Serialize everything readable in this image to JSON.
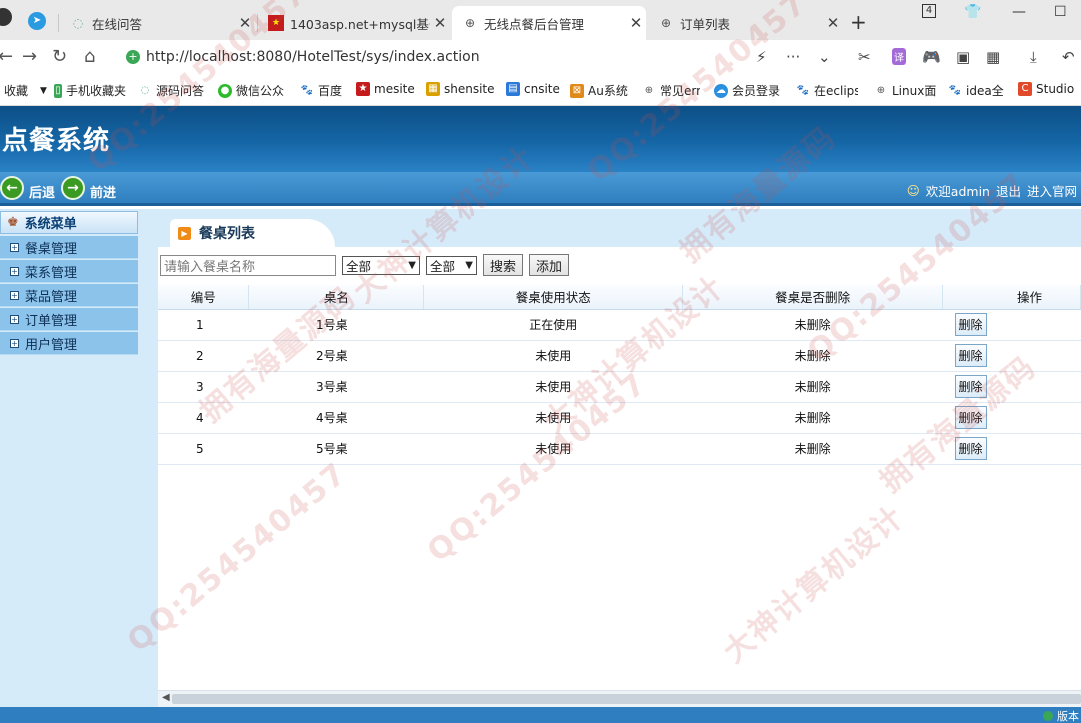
{
  "browser": {
    "tabs": [
      {
        "title": "在线问答",
        "favicon": "web-icon",
        "active": false
      },
      {
        "title": "1403asp.net+mysql基于",
        "favicon": "red-square-icon",
        "active": false
      },
      {
        "title": "无线点餐后台管理",
        "favicon": "globe-icon",
        "active": true
      },
      {
        "title": "订单列表",
        "favicon": "globe-icon",
        "active": false
      }
    ],
    "tab_badge": "4",
    "url": "http://localhost:8080/HotelTest/sys/index.action",
    "url_host": "localhost",
    "bookmarks": [
      {
        "label": "收藏",
        "icon": "caret-down-icon"
      },
      {
        "label": "手机收藏夹",
        "icon": "phone-icon"
      },
      {
        "label": "源码问答",
        "icon": "web-icon"
      },
      {
        "label": "微信公众",
        "icon": "wechat-icon"
      },
      {
        "label": "百度",
        "icon": "baidu-paw-icon"
      },
      {
        "label": "mesite",
        "icon": "red-square-icon"
      },
      {
        "label": "shensite",
        "icon": "grid-icon"
      },
      {
        "label": "cnsite",
        "icon": "doc-icon"
      },
      {
        "label": "Au系统",
        "icon": "x-box-icon"
      },
      {
        "label": "常见err",
        "icon": "globe-icon"
      },
      {
        "label": "会员登录",
        "icon": "cloud-icon"
      },
      {
        "label": "在eclips",
        "icon": "baidu-paw-icon"
      },
      {
        "label": "Linux面",
        "icon": "globe-icon"
      },
      {
        "label": "idea全",
        "icon": "baidu-paw-icon"
      },
      {
        "label": "Studio",
        "icon": "c-icon"
      }
    ]
  },
  "app": {
    "title": "点餐系统",
    "nav": {
      "back": "后退",
      "forward": "前进"
    },
    "user": {
      "welcome": "欢迎admin",
      "logout": "退出",
      "portal": "进入官网"
    }
  },
  "sidebar": {
    "header": "系统菜单",
    "items": [
      "餐桌管理",
      "菜系管理",
      "菜品管理",
      "订单管理",
      "用户管理"
    ]
  },
  "main": {
    "tab_title": "餐桌列表",
    "search_placeholder": "请输入餐桌名称",
    "filter_status": "全部",
    "filter_deleted": "全部",
    "search_button": "搜索",
    "add_button": "添加",
    "columns": [
      "编号",
      "桌名",
      "餐桌使用状态",
      "餐桌是否删除",
      "操作"
    ],
    "rows": [
      {
        "id": "1",
        "name": "1号桌",
        "status": "正在使用",
        "deleted": "未删除",
        "action": "删除"
      },
      {
        "id": "2",
        "name": "2号桌",
        "status": "未使用",
        "deleted": "未删除",
        "action": "删除"
      },
      {
        "id": "3",
        "name": "3号桌",
        "status": "未使用",
        "deleted": "未删除",
        "action": "删除"
      },
      {
        "id": "4",
        "name": "4号桌",
        "status": "未使用",
        "deleted": "未删除",
        "action": "删除"
      },
      {
        "id": "5",
        "name": "5号桌",
        "status": "未使用",
        "deleted": "未删除",
        "action": "删除"
      }
    ]
  },
  "footer": {
    "version": "版本"
  },
  "watermarks": [
    "QQ:254540457",
    "拥有海量源码",
    "大神计算机设计"
  ],
  "colors": {
    "header": "#1566a6",
    "navstrip": "#2f7fc0",
    "sidebar": "#d6ebf9",
    "sidebar_item": "#8cc3ea",
    "accent_orange": "#f08b17"
  }
}
